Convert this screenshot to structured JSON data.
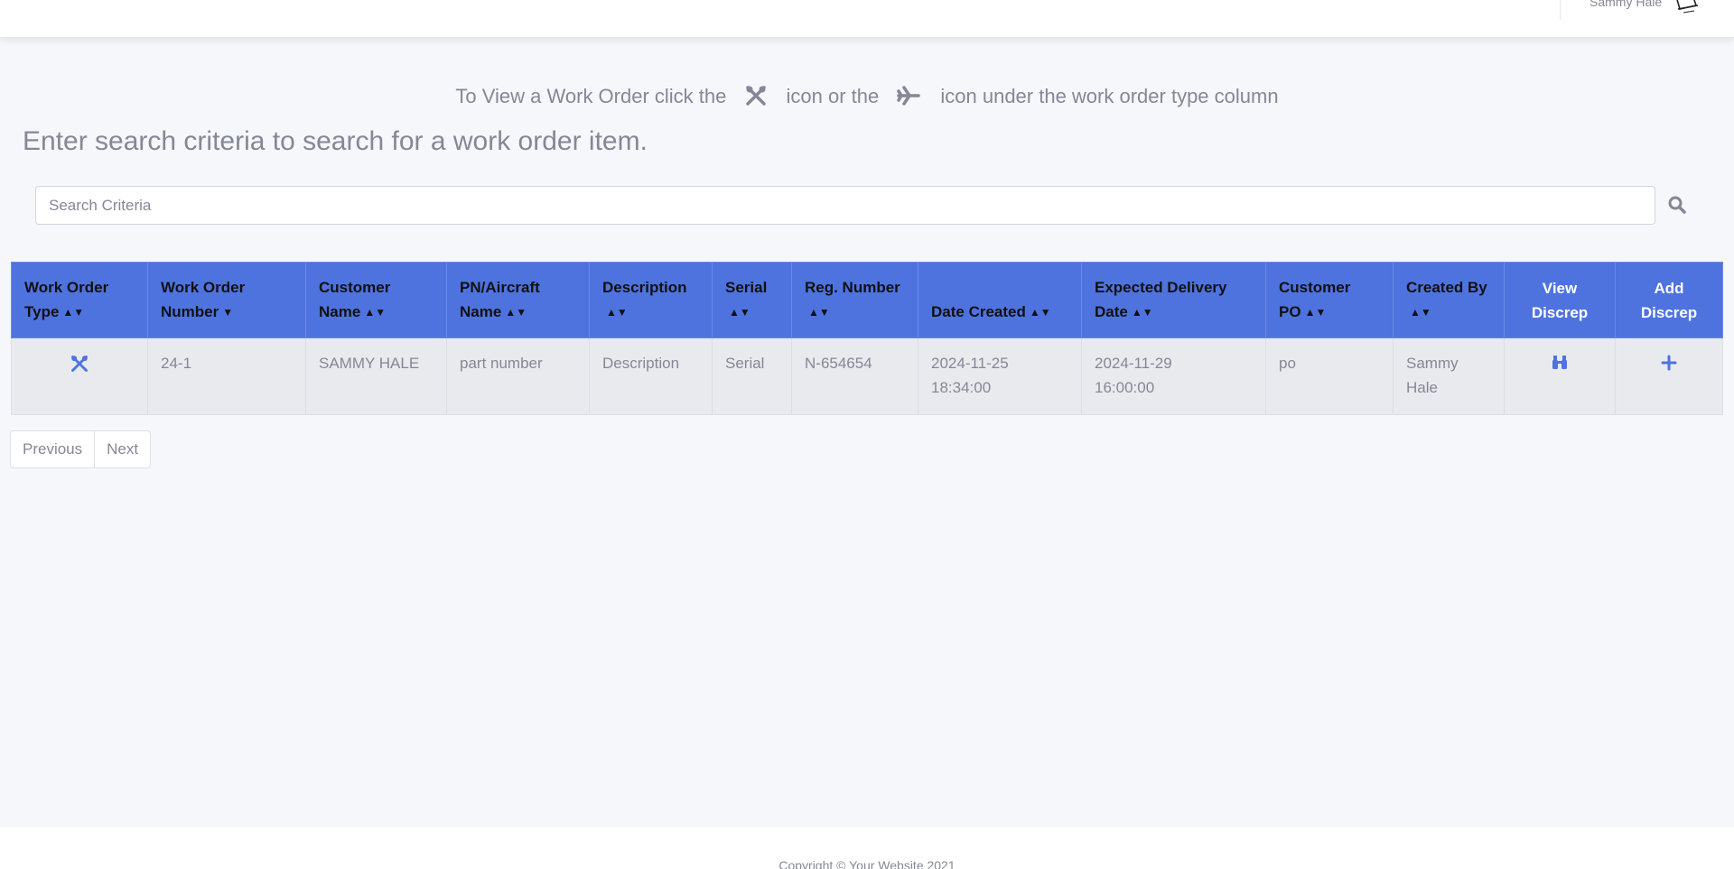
{
  "topbar": {
    "user_name": "Sammy Hale"
  },
  "instruction": {
    "part1": "To View a Work Order click the",
    "part2": "icon or the",
    "part3": "icon under the work order type column",
    "icon1": "tools-icon",
    "icon2": "plane-icon"
  },
  "heading": "Enter search criteria to search for a work order item.",
  "search": {
    "placeholder": "Search Criteria",
    "value": ""
  },
  "table": {
    "headers": [
      {
        "line1": "Work Order",
        "line2": "Type",
        "sort": "both"
      },
      {
        "line1": "Work Order",
        "line2": "Number",
        "sort": "desc"
      },
      {
        "line1": "Customer",
        "line2": "Name",
        "sort": "both"
      },
      {
        "line1": "PN/Aircraft",
        "line2": "Name",
        "sort": "both"
      },
      {
        "line1": "Description",
        "line2": "",
        "sort": "both"
      },
      {
        "line1": "Serial",
        "line2": "",
        "sort": "both"
      },
      {
        "line1": "Reg. Number",
        "line2": "",
        "sort": "both"
      },
      {
        "line1": "",
        "line2": "Date Created",
        "sort": "both"
      },
      {
        "line1": "Expected Delivery",
        "line2": "Date",
        "sort": "both"
      },
      {
        "line1": "Customer",
        "line2": "PO",
        "sort": "both"
      },
      {
        "line1": "Created By",
        "line2": "",
        "sort": "both"
      },
      {
        "line1": "View",
        "line2": "Discrep",
        "sort": "none"
      },
      {
        "line1": "Add",
        "line2": "Discrep",
        "sort": "none"
      }
    ],
    "rows": [
      {
        "type_icon": "tools-icon",
        "number": "24-1",
        "customer": "SAMMY HALE",
        "pn": "part number",
        "description": "Description",
        "serial": "Serial",
        "reg": "N-654654",
        "date_created_1": "2024-11-25",
        "date_created_2": "18:34:00",
        "expected_1": "2024-11-29",
        "expected_2": "16:00:00",
        "po": "po",
        "created_by_1": "Sammy",
        "created_by_2": "Hale",
        "view_icon": "binoculars-icon",
        "add_icon": "plus-icon"
      }
    ]
  },
  "pager": {
    "previous": "Previous",
    "next": "Next"
  },
  "footer": {
    "copyright": "Copyright © Your Website 2021"
  },
  "colors": {
    "header_bg": "#4e73df",
    "accent": "#4e73df",
    "page_bg": "#f5f7fb",
    "row_bg": "#e9eaee"
  }
}
